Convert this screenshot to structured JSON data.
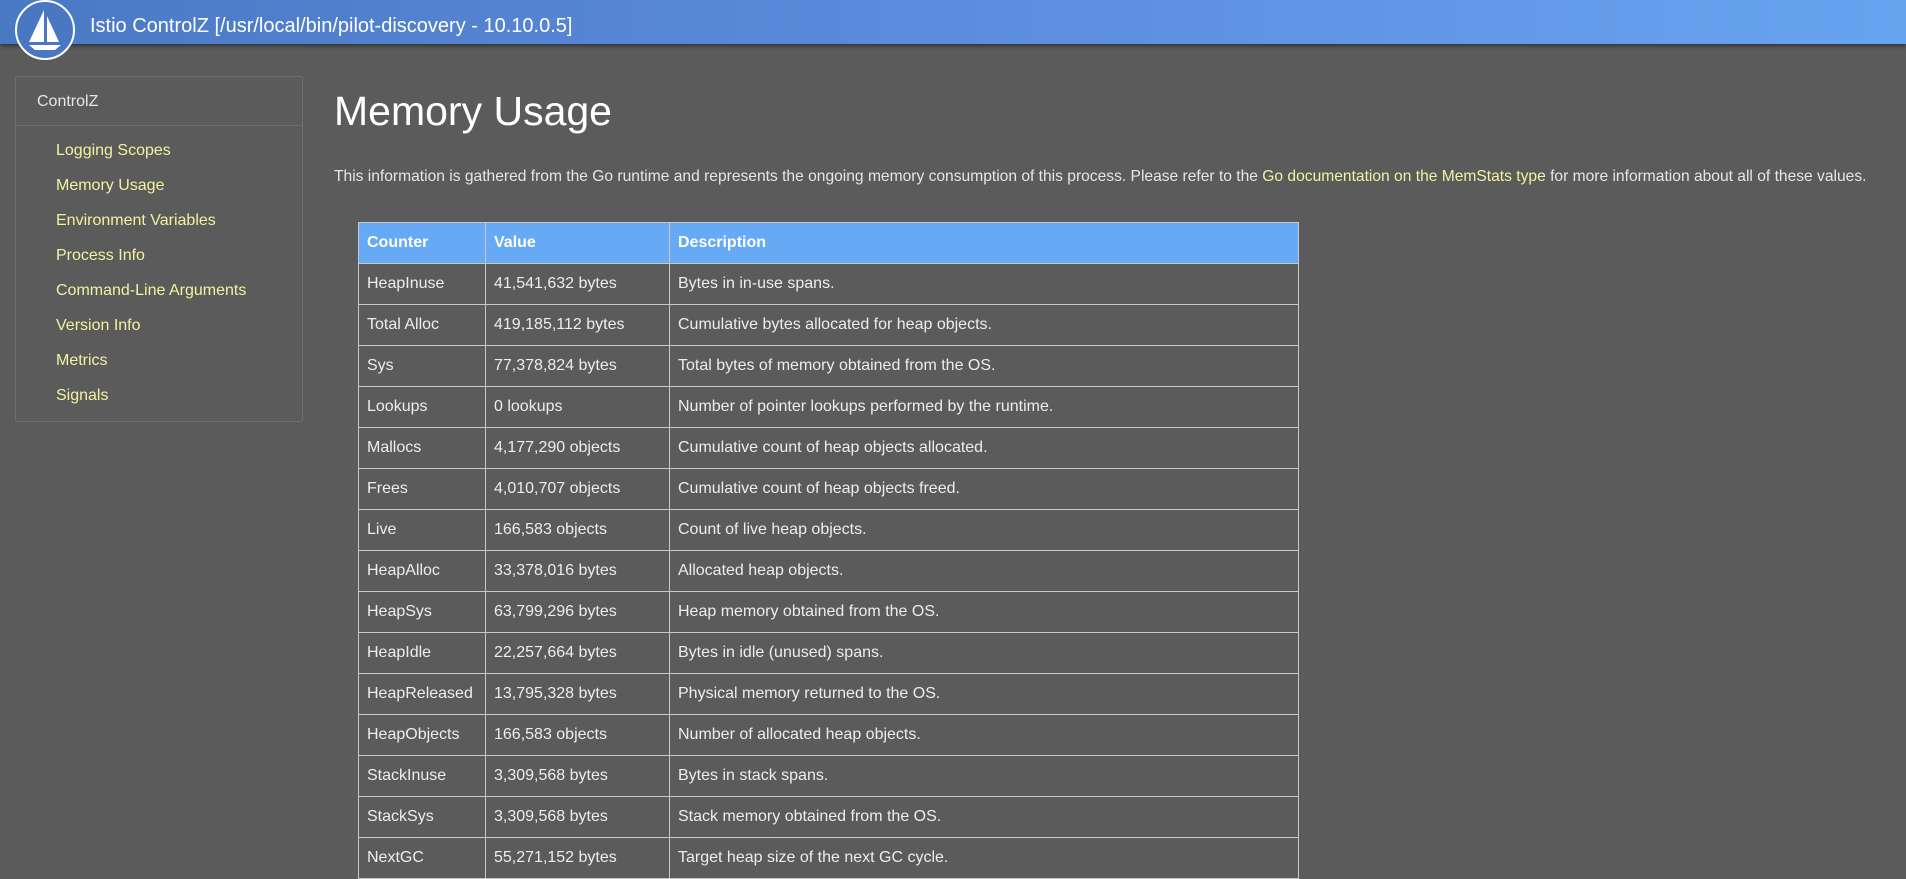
{
  "header": {
    "title": "Istio ControlZ [/usr/local/bin/pilot-discovery - 10.10.0.5]",
    "logo_icon": "istio-sailboat-logo"
  },
  "sidebar": {
    "heading": "ControlZ",
    "items": [
      {
        "label": "Logging Scopes"
      },
      {
        "label": "Memory Usage"
      },
      {
        "label": "Environment Variables"
      },
      {
        "label": "Process Info"
      },
      {
        "label": "Command-Line Arguments"
      },
      {
        "label": "Version Info"
      },
      {
        "label": "Metrics"
      },
      {
        "label": "Signals"
      }
    ]
  },
  "main": {
    "title": "Memory Usage",
    "intro_before": "This information is gathered from the Go runtime and represents the ongoing memory consumption of this process. Please refer to the ",
    "intro_link": "Go documentation on the MemStats type",
    "intro_after": " for more information about all of these values."
  },
  "table": {
    "headers": [
      "Counter",
      "Value",
      "Description"
    ],
    "rows": [
      [
        "HeapInuse",
        "41,541,632 bytes",
        "Bytes in in-use spans."
      ],
      [
        "Total Alloc",
        "419,185,112 bytes",
        "Cumulative bytes allocated for heap objects."
      ],
      [
        "Sys",
        "77,378,824 bytes",
        "Total bytes of memory obtained from the OS."
      ],
      [
        "Lookups",
        "0 lookups",
        "Number of pointer lookups performed by the runtime."
      ],
      [
        "Mallocs",
        "4,177,290 objects",
        "Cumulative count of heap objects allocated."
      ],
      [
        "Frees",
        "4,010,707 objects",
        "Cumulative count of heap objects freed."
      ],
      [
        "Live",
        "166,583 objects",
        "Count of live heap objects."
      ],
      [
        "HeapAlloc",
        "33,378,016 bytes",
        "Allocated heap objects."
      ],
      [
        "HeapSys",
        "63,799,296 bytes",
        "Heap memory obtained from the OS."
      ],
      [
        "HeapIdle",
        "22,257,664 bytes",
        "Bytes in idle (unused) spans."
      ],
      [
        "HeapReleased",
        "13,795,328 bytes",
        "Physical memory returned to the OS."
      ],
      [
        "HeapObjects",
        "166,583 objects",
        "Number of allocated heap objects."
      ],
      [
        "StackInuse",
        "3,309,568 bytes",
        "Bytes in stack spans."
      ],
      [
        "StackSys",
        "3,309,568 bytes",
        "Stack memory obtained from the OS."
      ],
      [
        "NextGC",
        "55,271,152 bytes",
        "Target heap size of the next GC cycle."
      ]
    ]
  },
  "colors": {
    "background": "#5b5b5b",
    "header_gradient_start": "#4a79c4",
    "header_gradient_end": "#67a4f0",
    "table_header": "#66aaf5",
    "link": "#f2f2a0"
  }
}
